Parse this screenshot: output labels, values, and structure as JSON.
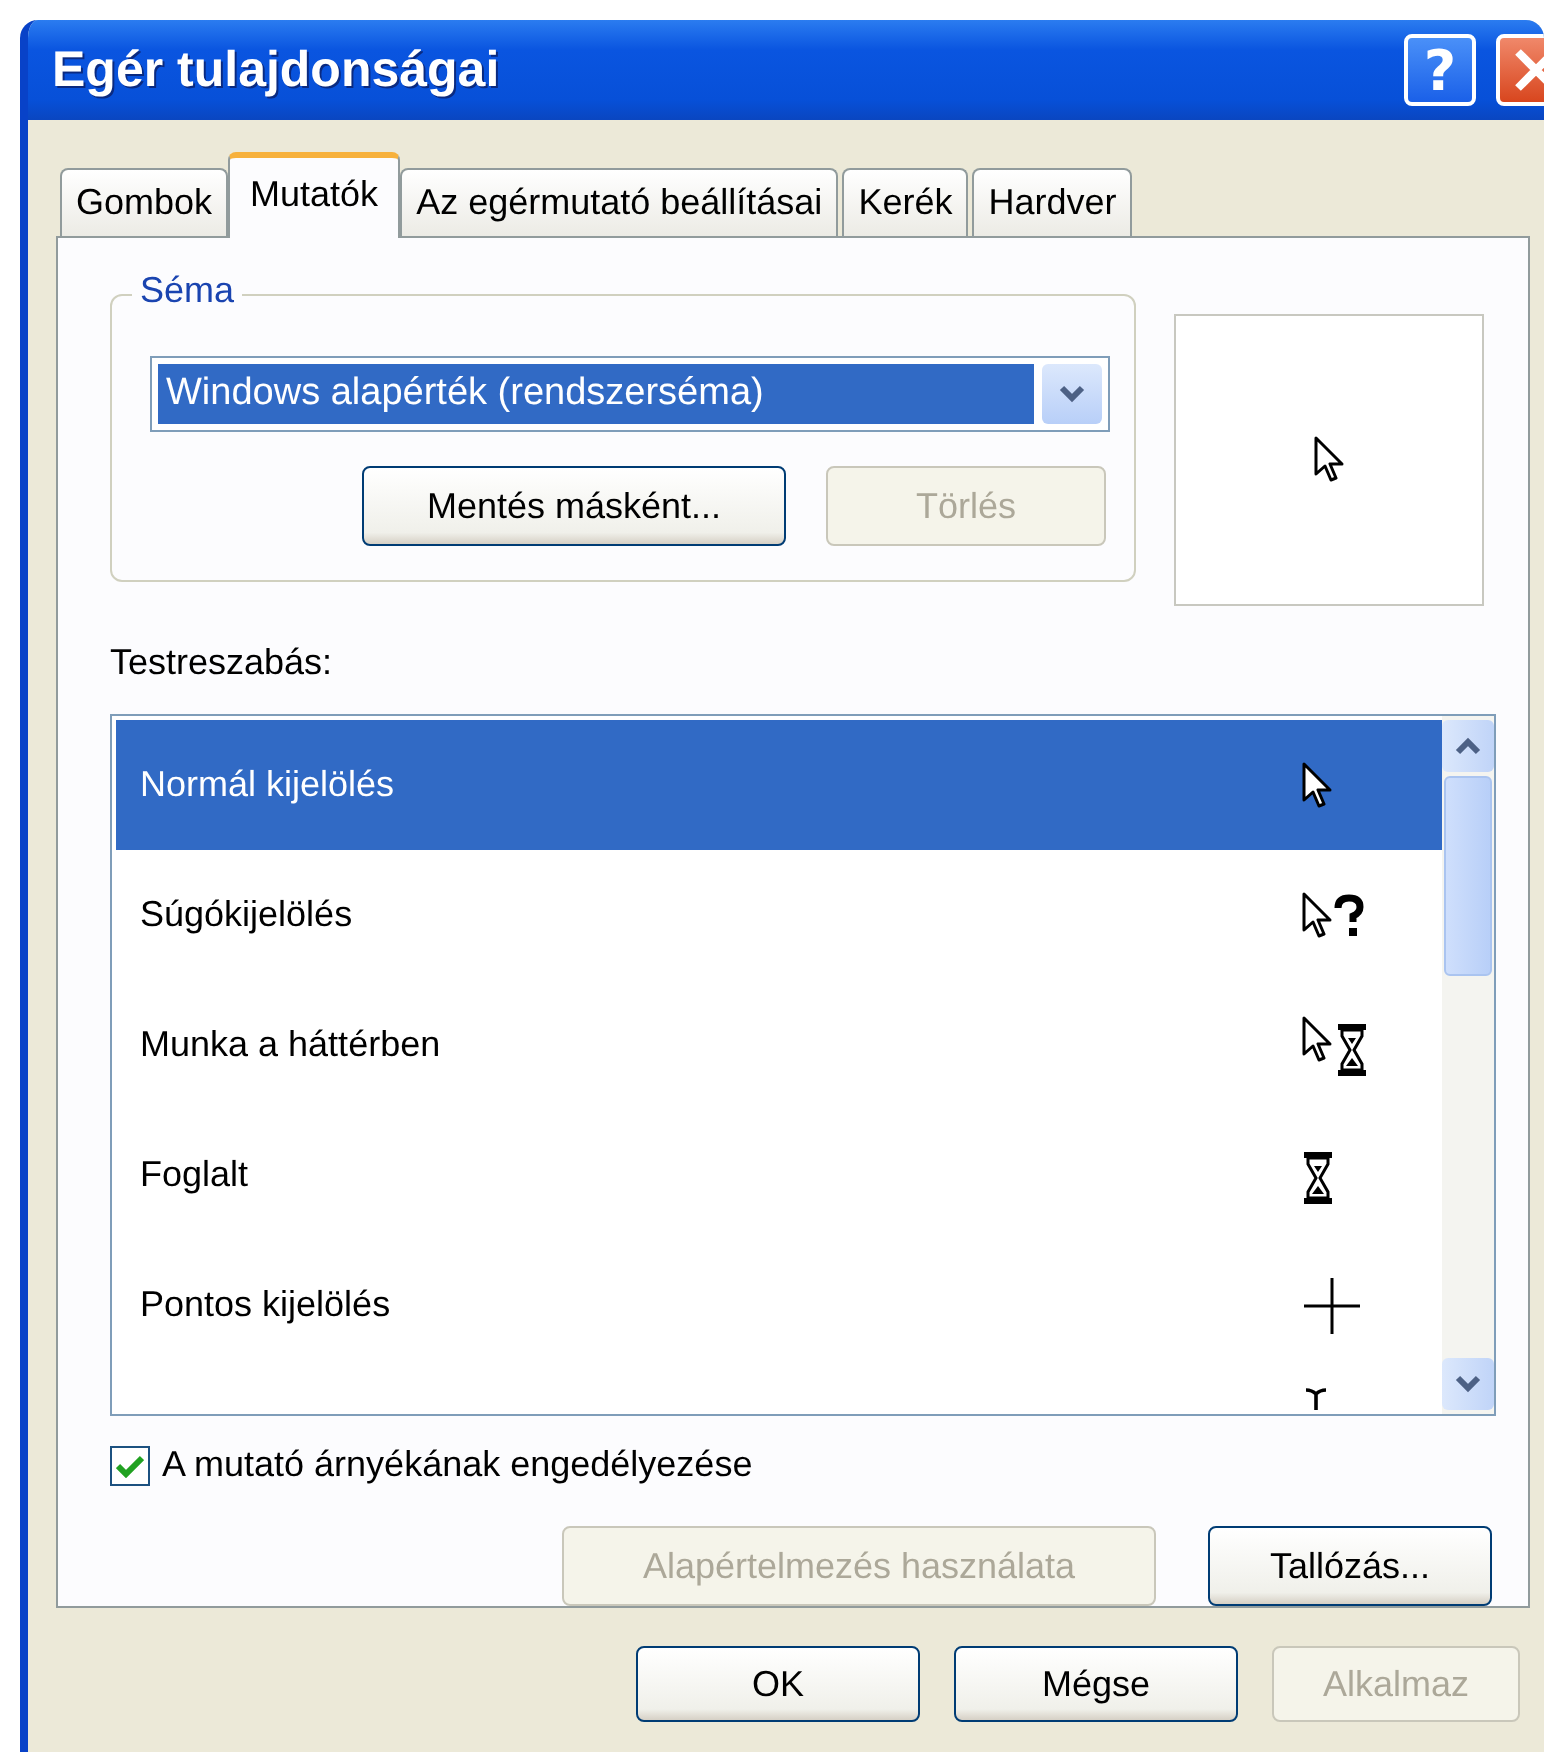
{
  "window": {
    "title": "Egér tulajdonságai",
    "help_button": "?"
  },
  "tabs": [
    {
      "label": "Gombok",
      "selected": false
    },
    {
      "label": "Mutatók",
      "selected": true
    },
    {
      "label": "Az egérmutató beállításai",
      "selected": false
    },
    {
      "label": "Kerék",
      "selected": false
    },
    {
      "label": "Hardver",
      "selected": false
    }
  ],
  "scheme": {
    "legend": "Séma",
    "value": "Windows alapérték (rendszerséma)",
    "buttons": [
      {
        "label": "Mentés másként...",
        "disabled": false
      },
      {
        "label": "Törlés",
        "disabled": true
      }
    ]
  },
  "preview": {
    "kind": "arrow"
  },
  "customize_label": "Testreszabás:",
  "cursors": [
    {
      "label": "Normál kijelölés",
      "kind": "arrow",
      "selected": true
    },
    {
      "label": "Súgókijelölés",
      "kind": "help",
      "selected": false
    },
    {
      "label": "Munka a háttérben",
      "kind": "working",
      "selected": false
    },
    {
      "label": "Foglalt",
      "kind": "busy",
      "selected": false
    },
    {
      "label": "Pontos kijelölés",
      "kind": "cross",
      "selected": false
    },
    {
      "kind": "text",
      "selected": false
    }
  ],
  "shadow_checkbox": {
    "label": "A mutató árnyékának engedélyezése",
    "checked": true
  },
  "list_buttons": [
    {
      "label": "Alapértelmezés használata",
      "disabled": true
    },
    {
      "label": "Tallózás...",
      "disabled": false
    }
  ],
  "footer_buttons": [
    {
      "label": "OK",
      "disabled": false
    },
    {
      "label": "Mégse",
      "disabled": false
    },
    {
      "label": "Alkalmaz",
      "disabled": true
    }
  ]
}
